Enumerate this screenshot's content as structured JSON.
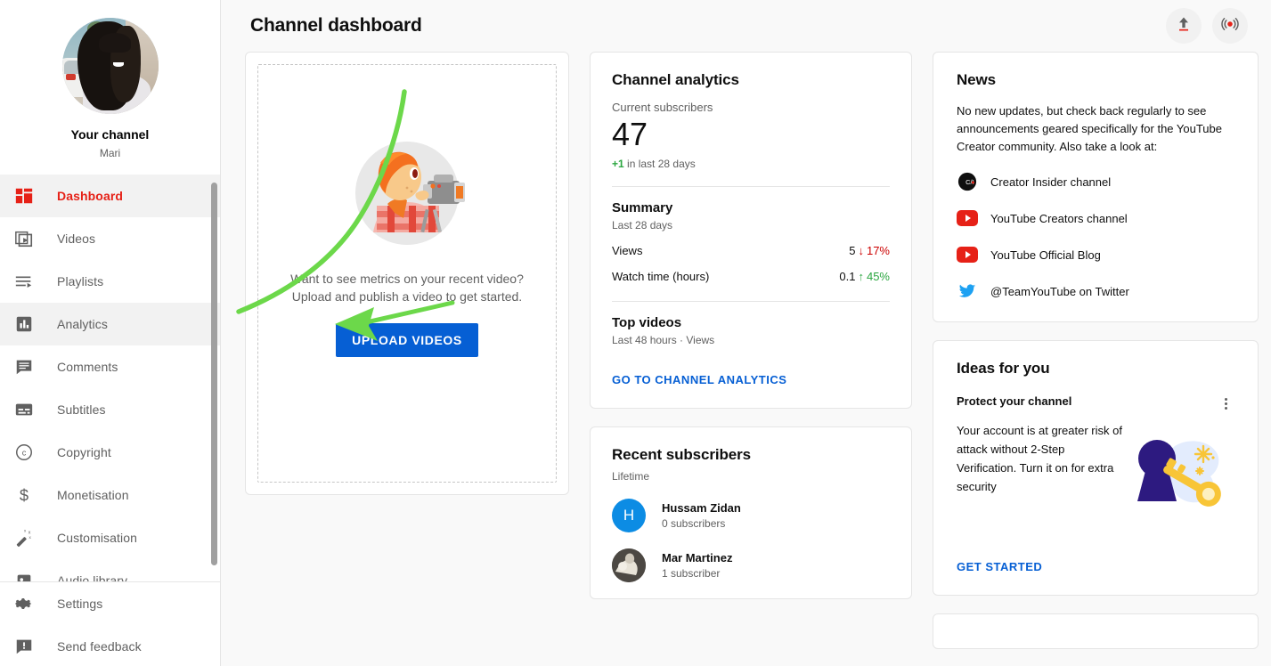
{
  "sidebar": {
    "channel_label": "Your channel",
    "channel_name": "Mari",
    "avatar_name": "channel-avatar",
    "items": [
      {
        "label": "Dashboard",
        "icon": "dashboard-icon",
        "state": "active"
      },
      {
        "label": "Videos",
        "icon": "videos-icon",
        "state": "default"
      },
      {
        "label": "Playlists",
        "icon": "playlists-icon",
        "state": "default"
      },
      {
        "label": "Analytics",
        "icon": "analytics-icon",
        "state": "hovered"
      },
      {
        "label": "Comments",
        "icon": "comments-icon",
        "state": "default"
      },
      {
        "label": "Subtitles",
        "icon": "subtitles-icon",
        "state": "default"
      },
      {
        "label": "Copyright",
        "icon": "copyright-icon",
        "state": "default"
      },
      {
        "label": "Monetisation",
        "icon": "dollar-icon",
        "state": "default"
      },
      {
        "label": "Customisation",
        "icon": "magic-wand-icon",
        "state": "default"
      },
      {
        "label": "Audio library",
        "icon": "audio-library-icon",
        "state": "clipped"
      }
    ],
    "footer_items": [
      {
        "label": "Settings",
        "icon": "gear-icon"
      },
      {
        "label": "Send feedback",
        "icon": "feedback-icon"
      }
    ]
  },
  "header": {
    "title": "Channel dashboard",
    "upload_icon": "upload-icon",
    "golive_icon": "go-live-icon"
  },
  "upload_card": {
    "illustration": "videographer-illustration",
    "line1": "Want to see metrics on your recent video?",
    "line2": "Upload and publish a video to get started.",
    "button_label": "UPLOAD VIDEOS"
  },
  "analytics_card": {
    "title": "Channel analytics",
    "subscribers_label": "Current subscribers",
    "subscribers_value": "47",
    "delta_value": "+1",
    "delta_suffix": "in last 28 days",
    "summary_title": "Summary",
    "summary_range": "Last 28 days",
    "metrics": [
      {
        "label": "Views",
        "value": "5",
        "direction": "down",
        "arrow": "↓",
        "percent": "17%"
      },
      {
        "label": "Watch time (hours)",
        "value": "0.1",
        "direction": "up",
        "arrow": "↑",
        "percent": "45%"
      }
    ],
    "top_videos_title": "Top videos",
    "top_videos_sub": "Last 48 hours · Views",
    "cta": "GO TO CHANNEL ANALYTICS"
  },
  "subscribers_card": {
    "title": "Recent subscribers",
    "range": "Lifetime",
    "rows": [
      {
        "name": "Hussam Zidan",
        "count": "0 subscribers",
        "avatar_type": "letter",
        "initial": "H",
        "color": "#0c8ce4"
      },
      {
        "name": "Mar Martinez",
        "count": "1 subscriber",
        "avatar_type": "photo",
        "initial": "",
        "color": "#8d8d8d"
      }
    ]
  },
  "news_card": {
    "title": "News",
    "body": "No new updates, but check back regularly to see announcements geared specifically for the YouTube Creator community. Also take a look at:",
    "links": [
      {
        "label": "Creator Insider channel",
        "icon": "creator-insider-icon"
      },
      {
        "label": "YouTube Creators channel",
        "icon": "youtube-icon"
      },
      {
        "label": "YouTube Official Blog",
        "icon": "youtube-icon"
      },
      {
        "label": "@TeamYouTube on Twitter",
        "icon": "twitter-icon"
      }
    ]
  },
  "ideas_card": {
    "title": "Ideas for you",
    "item_title": "Protect your channel",
    "item_body": "Your account is at greater risk of attack without 2-Step Verification. Turn it on for extra security",
    "illustration": "lock-and-key-illustration",
    "cta": "GET STARTED",
    "menu_icon": "kebab-menu-icon"
  },
  "annotation": {
    "type": "hand-drawn-arrow",
    "color": "#6cd84a",
    "points_to": "Analytics"
  },
  "colors": {
    "accent_red": "#e62117",
    "link_blue": "#065fd4",
    "up_green": "#2ba640",
    "down_red": "#cc0000",
    "page_bg": "#f9f9f9"
  }
}
